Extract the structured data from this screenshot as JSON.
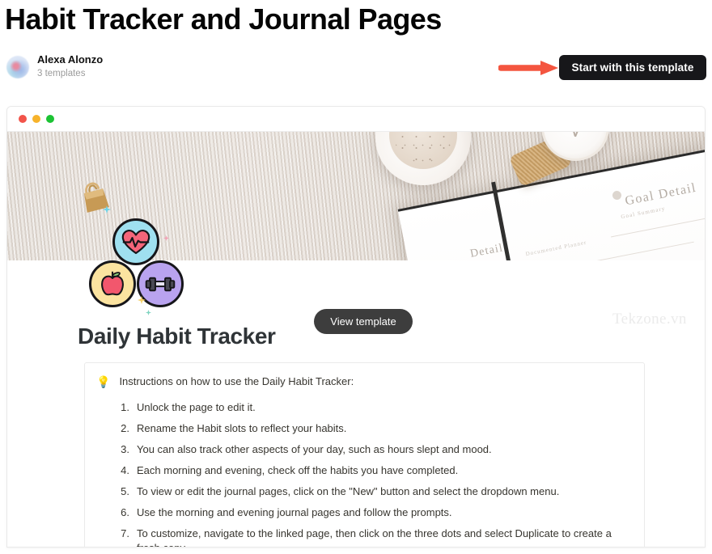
{
  "header": {
    "title": "Habit Tracker and Journal Pages",
    "author": {
      "name": "Alexa Alonzo",
      "templates_count": "3 templates",
      "avatar_icon": "user-avatar"
    },
    "cta_label": "Start with this template",
    "annotation_icon": "red-arrow-icon",
    "annotation_color": "#f4553f",
    "cta_background": "#17171a"
  },
  "browser_window": {
    "traffic_lights": [
      {
        "name": "close",
        "color": "#f2544a"
      },
      {
        "name": "minimize",
        "color": "#f7b32b"
      },
      {
        "name": "maximize",
        "color": "#1cc334"
      }
    ]
  },
  "hero": {
    "alt": "desk flatlay with coffee cup, gold watch, binder clip and open journal",
    "notebook_heading": "Goal Detail",
    "notebook_subheading": "Goal Summary",
    "notebook_heading_2": "Detail",
    "notebook_subheading_2": "Documented Planner",
    "habit_icons": [
      {
        "name": "heartbeat-icon",
        "color": "#9fe0f0"
      },
      {
        "name": "apple-icon",
        "color": "#fbe3a0"
      },
      {
        "name": "dumbbell-icon",
        "color": "#b9a3ef"
      }
    ]
  },
  "content": {
    "view_template_label": "View template",
    "watermark": "Tekzone.vn",
    "doc_title": "Daily Habit Tracker",
    "callout": {
      "icon": "lightbulb-icon",
      "title": "Instructions on how to use the Daily Habit Tracker:",
      "steps": [
        {
          "num": "1.",
          "text": "Unlock the page to edit it."
        },
        {
          "num": "2.",
          "text": "Rename the Habit slots to reflect your habits."
        },
        {
          "num": "3.",
          "text": "You can also track other aspects of your day, such as hours slept and mood."
        },
        {
          "num": "4.",
          "text": "Each morning and evening, check off the habits you have completed."
        },
        {
          "num": "5.",
          "text": "To view or edit the journal pages, click on the \"New\" button and select the dropdown menu."
        },
        {
          "num": "6.",
          "text": "Use the morning and evening journal pages and follow the prompts."
        },
        {
          "num": "7.",
          "text": "To customize, navigate to the linked page, then click on the three dots and select Duplicate to create a fresh copy."
        }
      ]
    }
  }
}
